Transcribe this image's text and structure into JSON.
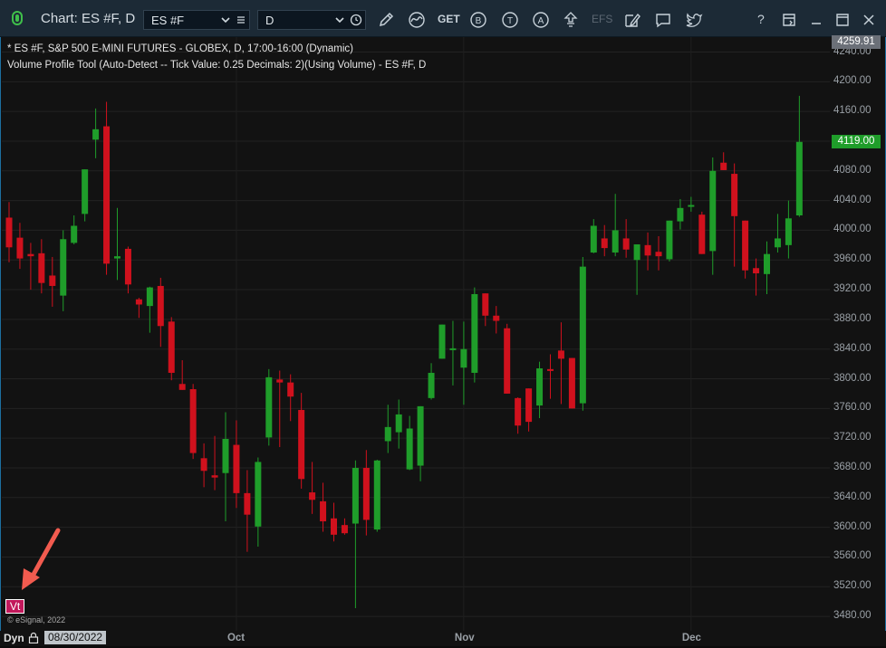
{
  "window": {
    "title": "Chart: ES #F, D"
  },
  "toolbar": {
    "symbol_value": "ES #F",
    "interval_value": "D",
    "get_label": "GET",
    "b_label": "B",
    "t_label": "T",
    "a_label": "A",
    "efs_label": "EFS",
    "help_label": "?"
  },
  "chart_info": {
    "line1": "* ES #F, S&P 500 E-MINI FUTURES - GLOBEX, D, 17:00-16:00 (Dynamic)",
    "line2": "Volume Profile Tool (Auto-Detect -- Tick Value: 0.25 Decimals: 2)(Using Volume) - ES #F, D"
  },
  "price_tags": {
    "top": "4259.91",
    "last": "4119.00"
  },
  "colors": {
    "up": "#1f9d2a",
    "down": "#d0111d",
    "last_tag": "#1f9d2a",
    "top_tag": "#6b7078",
    "frame": "#1d6fa0",
    "badge": "#c2185b",
    "annotation": "#f25b4f"
  },
  "footer": {
    "dyn_label": "Dyn",
    "date_value": "08/30/2022",
    "vt_badge": "Vt",
    "copyright": "© eSignal, 2022"
  },
  "chart_data": {
    "type": "candlestick",
    "title": "ES #F, D",
    "ylim": [
      3460,
      4260
    ],
    "y_ticks": [
      "4240.00",
      "4200.00",
      "4160.00",
      "4120.00",
      "4080.00",
      "4040.00",
      "4000.00",
      "3960.00",
      "3920.00",
      "3880.00",
      "3840.00",
      "3800.00",
      "3760.00",
      "3720.00",
      "3680.00",
      "3640.00",
      "3600.00",
      "3560.00",
      "3520.00",
      "3480.00"
    ],
    "x_labels": [
      {
        "label": "Oct",
        "index": 21
      },
      {
        "label": "Nov",
        "index": 42
      },
      {
        "label": "Dec",
        "index": 63
      }
    ],
    "bars": [
      {
        "o": 4017,
        "h": 4038,
        "l": 3957,
        "c": 3977
      },
      {
        "o": 3990,
        "h": 4010,
        "l": 3948,
        "c": 3962
      },
      {
        "o": 3968,
        "h": 3983,
        "l": 3920,
        "c": 3965
      },
      {
        "o": 3969,
        "h": 3988,
        "l": 3915,
        "c": 3929
      },
      {
        "o": 3939,
        "h": 3964,
        "l": 3897,
        "c": 3925
      },
      {
        "o": 3912,
        "h": 4000,
        "l": 3891,
        "c": 3988
      },
      {
        "o": 3983,
        "h": 4020,
        "l": 3981,
        "c": 4006
      },
      {
        "o": 4022,
        "h": 4080,
        "l": 4012,
        "c": 4082
      },
      {
        "o": 4122,
        "h": 4164,
        "l": 4097,
        "c": 4136
      },
      {
        "o": 4140,
        "h": 4173,
        "l": 3940,
        "c": 3955
      },
      {
        "o": 3962,
        "h": 4030,
        "l": 3933,
        "c": 3965
      },
      {
        "o": 3975,
        "h": 3978,
        "l": 3915,
        "c": 3927
      },
      {
        "o": 3907,
        "h": 3909,
        "l": 3882,
        "c": 3900
      },
      {
        "o": 3898,
        "h": 3924,
        "l": 3862,
        "c": 3923
      },
      {
        "o": 3925,
        "h": 3936,
        "l": 3843,
        "c": 3871
      },
      {
        "o": 3877,
        "h": 3883,
        "l": 3798,
        "c": 3808
      },
      {
        "o": 3793,
        "h": 3825,
        "l": 3786,
        "c": 3785
      },
      {
        "o": 3786,
        "h": 3793,
        "l": 3692,
        "c": 3700
      },
      {
        "o": 3693,
        "h": 3713,
        "l": 3654,
        "c": 3676
      },
      {
        "o": 3670,
        "h": 3723,
        "l": 3650,
        "c": 3667
      },
      {
        "o": 3673,
        "h": 3755,
        "l": 3608,
        "c": 3719
      },
      {
        "o": 3711,
        "h": 3744,
        "l": 3626,
        "c": 3646
      },
      {
        "o": 3646,
        "h": 3677,
        "l": 3567,
        "c": 3617
      },
      {
        "o": 3601,
        "h": 3694,
        "l": 3574,
        "c": 3688
      },
      {
        "o": 3721,
        "h": 3813,
        "l": 3710,
        "c": 3802
      },
      {
        "o": 3799,
        "h": 3811,
        "l": 3708,
        "c": 3795
      },
      {
        "o": 3795,
        "h": 3806,
        "l": 3743,
        "c": 3776
      },
      {
        "o": 3758,
        "h": 3781,
        "l": 3652,
        "c": 3665
      },
      {
        "o": 3647,
        "h": 3688,
        "l": 3618,
        "c": 3637
      },
      {
        "o": 3635,
        "h": 3660,
        "l": 3594,
        "c": 3608
      },
      {
        "o": 3612,
        "h": 3633,
        "l": 3581,
        "c": 3590
      },
      {
        "o": 3603,
        "h": 3612,
        "l": 3590,
        "c": 3592
      },
      {
        "o": 3605,
        "h": 3690,
        "l": 3491,
        "c": 3680
      },
      {
        "o": 3680,
        "h": 3704,
        "l": 3589,
        "c": 3610
      },
      {
        "o": 3597,
        "h": 3691,
        "l": 3594,
        "c": 3690
      },
      {
        "o": 3716,
        "h": 3765,
        "l": 3700,
        "c": 3735
      },
      {
        "o": 3728,
        "h": 3772,
        "l": 3706,
        "c": 3752
      },
      {
        "o": 3678,
        "h": 3750,
        "l": 3677,
        "c": 3733
      },
      {
        "o": 3683,
        "h": 3718,
        "l": 3662,
        "c": 3763
      },
      {
        "o": 3774,
        "h": 3821,
        "l": 3772,
        "c": 3808
      },
      {
        "o": 3827,
        "h": 3863,
        "l": 3827,
        "c": 3873
      },
      {
        "o": 3841,
        "h": 3878,
        "l": 3791,
        "c": 3841
      },
      {
        "o": 3815,
        "h": 3877,
        "l": 3765,
        "c": 3840
      },
      {
        "o": 3808,
        "h": 3923,
        "l": 3795,
        "c": 3914
      },
      {
        "o": 3915,
        "h": 3913,
        "l": 3871,
        "c": 3885
      },
      {
        "o": 3885,
        "h": 3898,
        "l": 3861,
        "c": 3878
      },
      {
        "o": 3868,
        "h": 3874,
        "l": 3781,
        "c": 3780
      },
      {
        "o": 3774,
        "h": 3775,
        "l": 3726,
        "c": 3737
      },
      {
        "o": 3787,
        "h": 3787,
        "l": 3729,
        "c": 3742
      },
      {
        "o": 3764,
        "h": 3823,
        "l": 3747,
        "c": 3814
      },
      {
        "o": 3813,
        "h": 3833,
        "l": 3773,
        "c": 3812
      },
      {
        "o": 3838,
        "h": 3876,
        "l": 3766,
        "c": 3827
      },
      {
        "o": 3828,
        "h": 3828,
        "l": 3761,
        "c": 3760
      },
      {
        "o": 3767,
        "h": 3964,
        "l": 3757,
        "c": 3951
      },
      {
        "o": 3970,
        "h": 4015,
        "l": 3969,
        "c": 4006
      },
      {
        "o": 3989,
        "h": 4007,
        "l": 3965,
        "c": 3976
      },
      {
        "o": 3970,
        "h": 4049,
        "l": 3965,
        "c": 4000
      },
      {
        "o": 3989,
        "h": 4015,
        "l": 3963,
        "c": 3974
      },
      {
        "o": 3960,
        "h": 3963,
        "l": 3913,
        "c": 3981
      },
      {
        "o": 3980,
        "h": 3997,
        "l": 3946,
        "c": 3966
      },
      {
        "o": 3971,
        "h": 3992,
        "l": 3946,
        "c": 3965
      },
      {
        "o": 3961,
        "h": 3996,
        "l": 3958,
        "c": 4013
      },
      {
        "o": 4012,
        "h": 4042,
        "l": 4001,
        "c": 4030
      },
      {
        "o": 4032,
        "h": 4045,
        "l": 4025,
        "c": 4034
      },
      {
        "o": 4021,
        "h": 4025,
        "l": 3969,
        "c": 3968
      },
      {
        "o": 3972,
        "h": 4098,
        "l": 3940,
        "c": 4080
      },
      {
        "o": 4091,
        "h": 4105,
        "l": 4092,
        "c": 4081
      },
      {
        "o": 4076,
        "h": 4090,
        "l": 3951,
        "c": 4019
      },
      {
        "o": 4013,
        "h": 4002,
        "l": 3935,
        "c": 3946
      },
      {
        "o": 3949,
        "h": 3962,
        "l": 3912,
        "c": 3942
      },
      {
        "o": 3941,
        "h": 3985,
        "l": 3914,
        "c": 3968
      },
      {
        "o": 3977,
        "h": 4022,
        "l": 3970,
        "c": 3989
      },
      {
        "o": 3980,
        "h": 4040,
        "l": 3962,
        "c": 4016
      },
      {
        "o": 4020,
        "h": 4181,
        "l": 4018,
        "c": 4119
      }
    ]
  }
}
